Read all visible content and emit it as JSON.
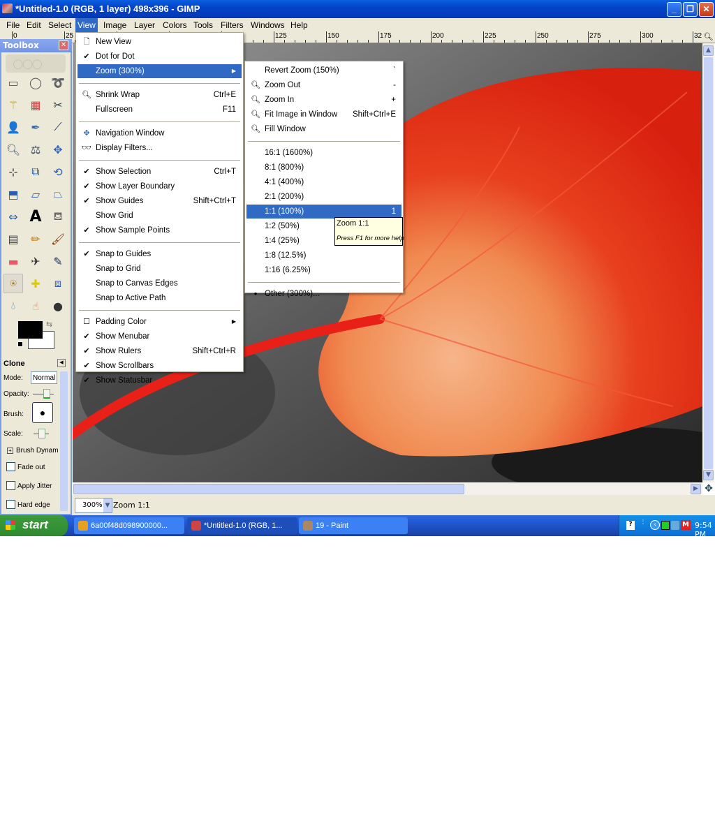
{
  "window": {
    "title": "*Untitled-1.0 (RGB, 1 layer) 498x396 - GIMP"
  },
  "menubar": [
    "File",
    "Edit",
    "Select",
    "View",
    "Image",
    "Layer",
    "Colors",
    "Tools",
    "Filters",
    "Windows",
    "Help"
  ],
  "menubar_active": "View",
  "ruler": {
    "labels": [
      "0",
      "25",
      "125",
      "150",
      "175",
      "200",
      "225",
      "250",
      "275",
      "300",
      "32"
    ]
  },
  "view_menu": [
    {
      "label": "New View",
      "mark": "page-icon"
    },
    {
      "label": "Dot for Dot",
      "mark": "check"
    },
    {
      "label": "Zoom (300%)",
      "submenu": true,
      "highlighted": true
    },
    {
      "sep": true
    },
    {
      "label": "Shrink Wrap",
      "shortcut": "Ctrl+E",
      "mark": "zoom-icon"
    },
    {
      "label": "Fullscreen",
      "shortcut": "F11"
    },
    {
      "sep": true
    },
    {
      "label": "Navigation Window",
      "mark": "navigate-icon"
    },
    {
      "label": "Display Filters...",
      "mark": "glasses-icon"
    },
    {
      "sep": true
    },
    {
      "label": "Show Selection",
      "shortcut": "Ctrl+T",
      "mark": "check"
    },
    {
      "label": "Show Layer Boundary",
      "mark": "check"
    },
    {
      "label": "Show Guides",
      "shortcut": "Shift+Ctrl+T",
      "mark": "check"
    },
    {
      "label": "Show Grid"
    },
    {
      "label": "Show Sample Points",
      "mark": "check"
    },
    {
      "sep": true
    },
    {
      "label": "Snap to Guides",
      "mark": "check"
    },
    {
      "label": "Snap to Grid"
    },
    {
      "label": "Snap to Canvas Edges"
    },
    {
      "label": "Snap to Active Path"
    },
    {
      "sep": true
    },
    {
      "label": "Padding Color",
      "submenu": true,
      "mark": "color-box"
    },
    {
      "label": "Show Menubar",
      "mark": "check"
    },
    {
      "label": "Show Rulers",
      "shortcut": "Shift+Ctrl+R",
      "mark": "check"
    },
    {
      "label": "Show Scrollbars",
      "mark": "check"
    },
    {
      "label": "Show Statusbar",
      "mark": "check"
    }
  ],
  "zoom_submenu": [
    {
      "label": "Revert Zoom (150%)",
      "shortcut": "`"
    },
    {
      "label": "Zoom Out",
      "shortcut": "-",
      "mark": "zoom-out-icon"
    },
    {
      "label": "Zoom In",
      "shortcut": "+",
      "mark": "zoom-in-icon"
    },
    {
      "label": "Fit Image in Window",
      "shortcut": "Shift+Ctrl+E",
      "mark": "zoom-fit-icon"
    },
    {
      "label": "Fill Window",
      "mark": "zoom-fill-icon"
    },
    {
      "sep": true
    },
    {
      "label": "16:1  (1600%)"
    },
    {
      "label": "8:1  (800%)"
    },
    {
      "label": "4:1  (400%)"
    },
    {
      "label": "2:1  (200%)"
    },
    {
      "label": "1:1  (100%)",
      "shortcut": "1",
      "highlighted": true
    },
    {
      "label": "1:2  (50%)"
    },
    {
      "label": "1:4  (25%)"
    },
    {
      "label": "1:8  (12.5%)"
    },
    {
      "label": "1:16  (6.25%)"
    },
    {
      "sep": true
    },
    {
      "label": "Other (300%)...",
      "mark": "radio"
    }
  ],
  "tooltip": {
    "title": "Zoom 1:1",
    "help": "Press F1 for more help"
  },
  "toolbox": {
    "title": "Toolbox",
    "tools": [
      "rect-select",
      "ellipse-select",
      "free-select",
      "fuzzy-select",
      "select-by-color",
      "scissors",
      "foreground-select",
      "paths",
      "color-picker",
      "zoom",
      "measure",
      "move",
      "align",
      "crop",
      "rotate",
      "scale",
      "shear",
      "perspective",
      "flip",
      "text",
      "bucket-fill",
      "blend",
      "pencil",
      "paintbrush",
      "eraser",
      "airbrush",
      "ink",
      "clone",
      "heal",
      "perspective-clone",
      "blur",
      "smudge",
      "dodge-burn"
    ],
    "selected_tool": "clone",
    "options": {
      "title": "Clone",
      "mode_label": "Mode:",
      "mode_value": "Normal",
      "opacity_label": "Opacity:",
      "brush_label": "Brush:",
      "scale_label": "Scale:",
      "brush_dynamics": "Brush Dynam",
      "fade_out": "Fade out",
      "apply_jitter": "Apply Jitter",
      "hard_edge": "Hard edge"
    }
  },
  "statusbar": {
    "zoom": "300%",
    "message": "Zoom 1:1"
  },
  "taskbar": {
    "start": "start",
    "tasks": [
      {
        "label": "6a00f48d098900000...",
        "active": false
      },
      {
        "label": "*Untitled-1.0 (RGB, 1...",
        "active": true
      },
      {
        "label": "19 - Paint",
        "active": false
      }
    ],
    "clock": "9:54 PM"
  },
  "colors": {
    "xp_blue": "#0a5fe0",
    "menu_highlight": "#316ac5",
    "menu_bg": "#ece9d8",
    "leaf_red": "#e8341c",
    "leaf_orange": "#f39a5a"
  }
}
